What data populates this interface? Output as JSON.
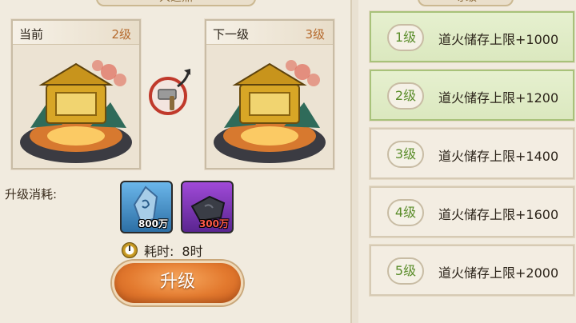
{
  "left_panel": {
    "title": "大道鼎",
    "current": {
      "label": "当前",
      "level": "2级"
    },
    "next": {
      "label": "下一级",
      "level": "3级"
    },
    "cost_label": "升级消耗:",
    "items": [
      {
        "qty": "800万",
        "icon": "blue-crystal-icon"
      },
      {
        "qty": "300万",
        "icon": "dark-stone-icon"
      }
    ],
    "time_label": "耗时:",
    "time_value": "8时",
    "upgrade_button": "升级"
  },
  "right_panel": {
    "title": "等级",
    "levels": [
      {
        "badge": "1级",
        "text": "道火储存上限+1000",
        "active": true
      },
      {
        "badge": "2级",
        "text": "道火储存上限+1200",
        "active": true
      },
      {
        "badge": "3级",
        "text": "道火储存上限+1400",
        "active": false
      },
      {
        "badge": "4级",
        "text": "道火储存上限+1600",
        "active": false
      },
      {
        "badge": "5级",
        "text": "道火储存上限+2000",
        "active": false
      }
    ]
  },
  "colors": {
    "accent_orange": "#e37a2f",
    "level_green": "#5a8d2a",
    "active_row": "#dbe8bf",
    "quantity_red": "#ff5a4a"
  }
}
